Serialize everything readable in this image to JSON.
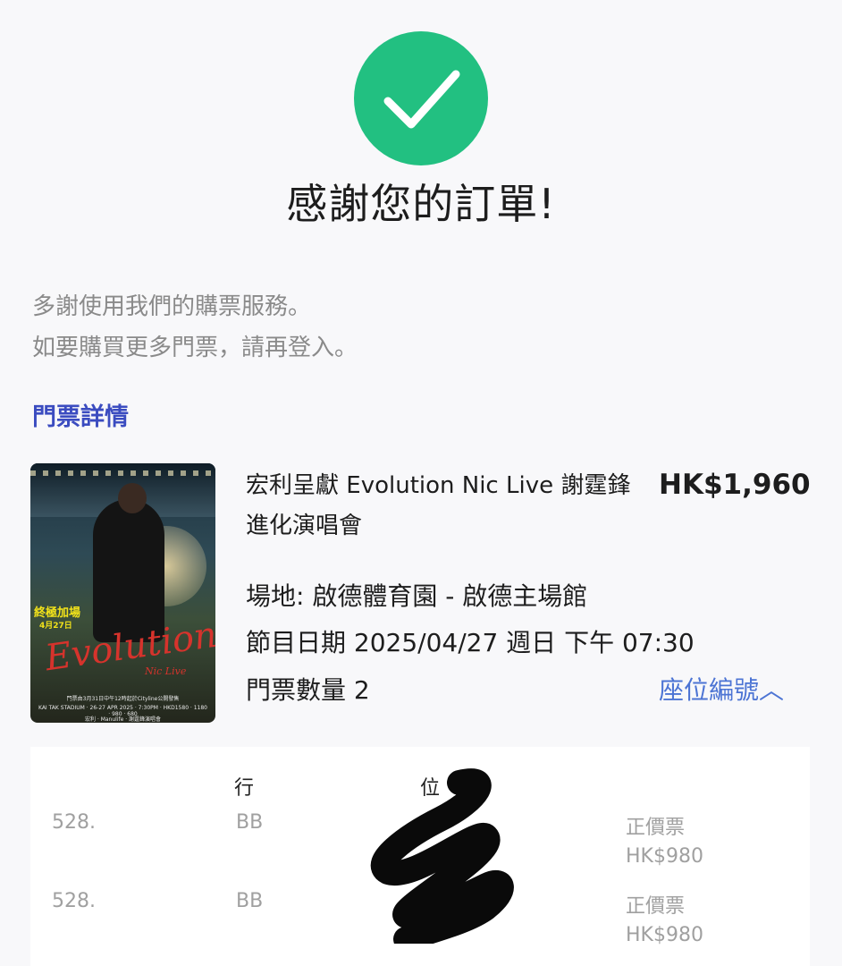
{
  "success": {
    "icon": "check-icon",
    "color": "#22c081",
    "title": "感謝您的訂單!"
  },
  "message": {
    "line1": "多謝使用我們的購票服務。",
    "line2": "如要購買更多門票，請再登入。"
  },
  "section_title": "門票詳情",
  "event": {
    "name": "宏利呈獻 Evolution Nic Live 謝霆鋒進化演唱會",
    "price": "HK$1,960",
    "venue": "場地: 啟德體育園 - 啟德主場館",
    "date": "節目日期 2025/04/27 週日 下午 07:30",
    "quantity": "門票數量 2",
    "seat_toggle": "座位編號︿"
  },
  "poster": {
    "badge": "終極加場",
    "badge_date": "4月27日",
    "sponsor": "Manulife 宏利",
    "logo": "Evolution",
    "logo_sub": "Nic Live",
    "fine1": "門票由3月31日中午12時起於Cityline公開發售",
    "fine2": "KAI TAK STADIUM · 26-27 APR 2025 · 7:30PM · HKD1580 · 1180 · 980 · 680",
    "fine3": "宏利 · Manulife · 謝霆鋒演唱會"
  },
  "seats": {
    "headers": {
      "section": "",
      "row": "行",
      "seat": "位",
      "type": ""
    },
    "rows": [
      {
        "section": "528.",
        "row": "BB",
        "seat": "",
        "type": "正價票",
        "price": "HK$980"
      },
      {
        "section": "528.",
        "row": "BB",
        "seat": "",
        "type": "正價票",
        "price": "HK$980"
      }
    ]
  }
}
